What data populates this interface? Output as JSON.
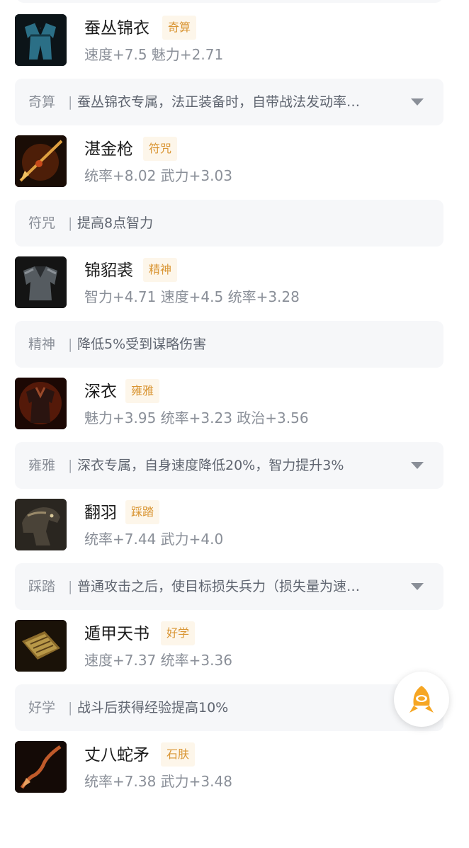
{
  "items": [
    {
      "name": "蚕丛锦衣",
      "tag": "奇算",
      "stats": "速度+7.5 魅力+2.71",
      "skill": {
        "tag": "奇算",
        "desc": "蚕丛锦衣专属，法正装备时，自带战法发动率…"
      },
      "expandable": true,
      "icon": "blue-robe-icon"
    },
    {
      "name": "湛金枪",
      "tag": "符咒",
      "stats": "统率+8.02 武力+3.03",
      "skill": {
        "tag": "符咒",
        "desc": "提高8点智力"
      },
      "expandable": false,
      "icon": "golden-spear-icon"
    },
    {
      "name": "锦貂裘",
      "tag": "精神",
      "stats": "智力+4.71 速度+4.5 统率+3.28",
      "skill": {
        "tag": "精神",
        "desc": "降低5%受到谋略伤害"
      },
      "expandable": false,
      "icon": "fur-coat-icon"
    },
    {
      "name": "深衣",
      "tag": "雍雅",
      "stats": "魅力+3.95 统率+3.23 政治+3.56",
      "skill": {
        "tag": "雍雅",
        "desc": "深衣专属，自身速度降低20%，智力提升3%"
      },
      "expandable": true,
      "icon": "dark-robe-icon"
    },
    {
      "name": "翻羽",
      "tag": "踩踏",
      "stats": "统率+7.44 武力+4.0",
      "skill": {
        "tag": "踩踏",
        "desc": "普通攻击之后，使目标损失兵力（损失量为速…"
      },
      "expandable": true,
      "icon": "warhorse-icon"
    },
    {
      "name": "遁甲天书",
      "tag": "好学",
      "stats": "速度+7.37 统率+3.36",
      "skill": {
        "tag": "好学",
        "desc": "战斗后获得经验提高10%"
      },
      "expandable": false,
      "icon": "scroll-book-icon"
    },
    {
      "name": "丈八蛇矛",
      "tag": "石肤",
      "stats": "统率+7.38 武力+3.48",
      "skill": null,
      "expandable": false,
      "icon": "serpent-spear-icon"
    }
  ],
  "skill_separator": "|",
  "floating_button_icon": "rocket-icon",
  "colors": {
    "tag_bg": "#fdf6ea",
    "tag_text": "#d99533",
    "card_bg": "#f6f7f9",
    "accent": "#f6a623"
  }
}
